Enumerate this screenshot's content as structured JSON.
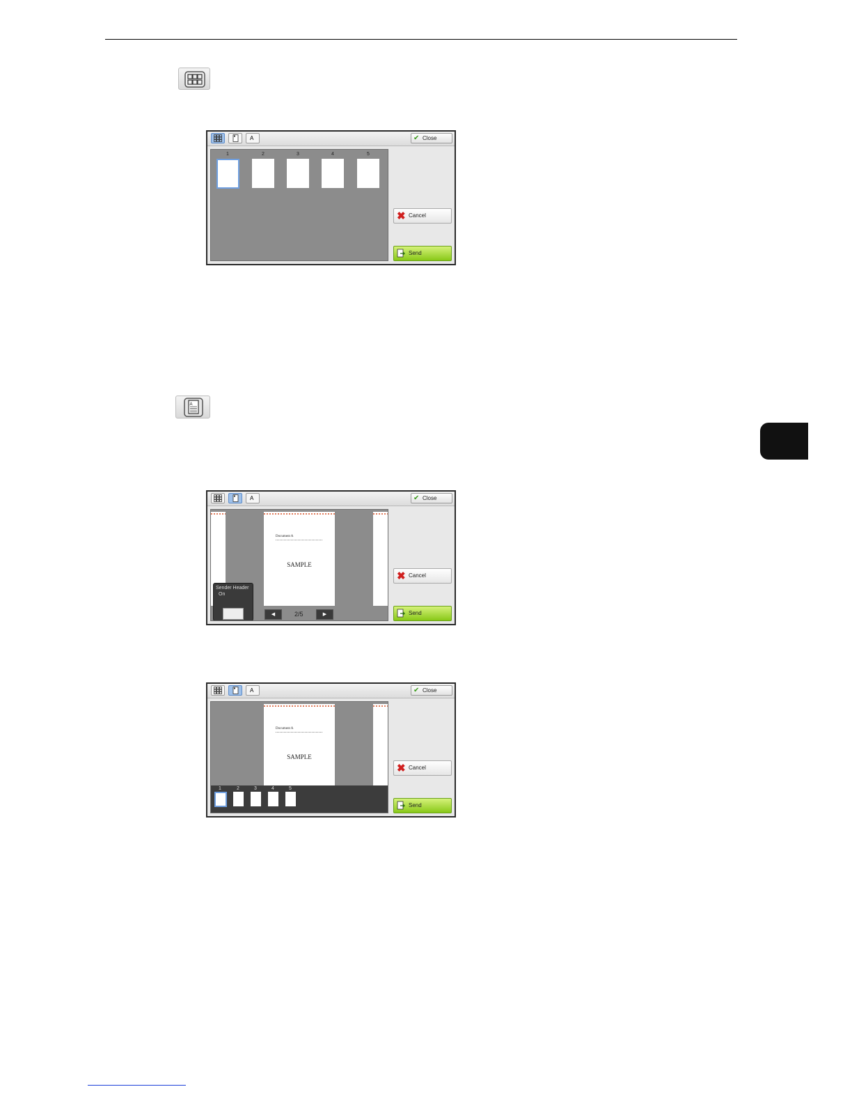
{
  "icons": {
    "thumbnail_view": "grid-icon",
    "page_view": "document-icon"
  },
  "screen": {
    "close_label": "Close",
    "cancel_label": "Cancel",
    "send_label": "Send",
    "toolbar_letter": "A",
    "thumb_numbers": [
      "1",
      "2",
      "3",
      "4",
      "5"
    ],
    "doc_label": "Document A",
    "sample_text": "SAMPLE",
    "page_indicator": "2/5",
    "prev_arrow": "◀",
    "next_arrow": "▶",
    "sender_header_label": "Sender Header",
    "sender_header_value": "On"
  },
  "colors": {
    "send_green": "#88c818",
    "cancel_red": "#d0201f",
    "selected_blue": "#6f9fe0",
    "chapter_tab": "#111111"
  }
}
